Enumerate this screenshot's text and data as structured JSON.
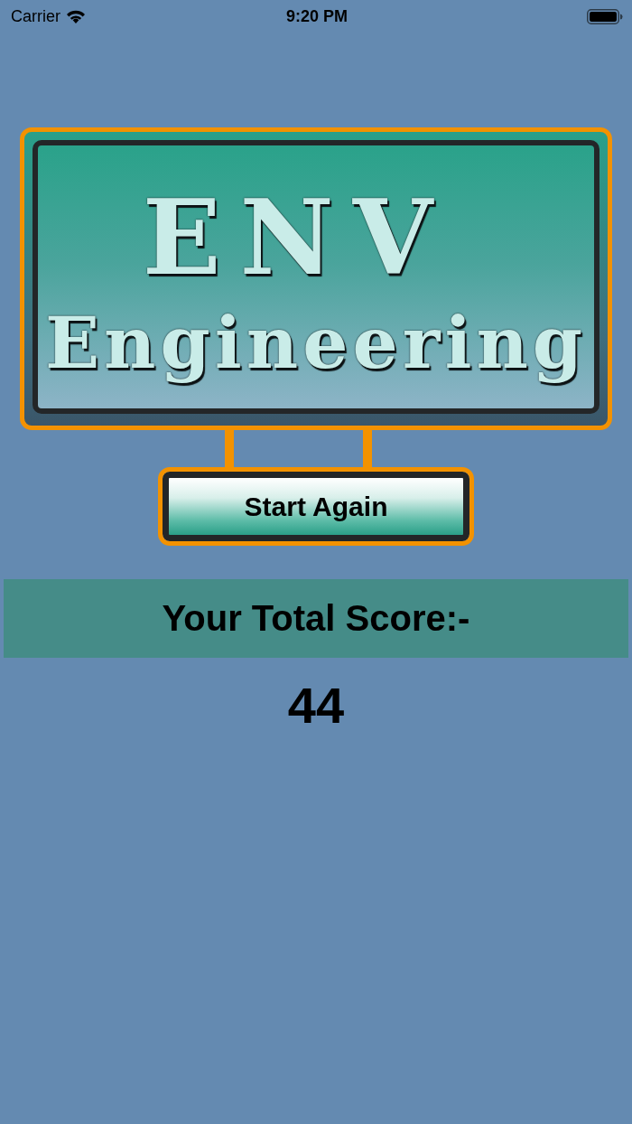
{
  "status_bar": {
    "carrier": "Carrier",
    "time": "9:20 PM"
  },
  "logo": {
    "line_1": "ENV",
    "line_2": "Engineering"
  },
  "start_button": {
    "label": "Start Again"
  },
  "score": {
    "heading": "Your Total Score:-",
    "value": "44"
  }
}
